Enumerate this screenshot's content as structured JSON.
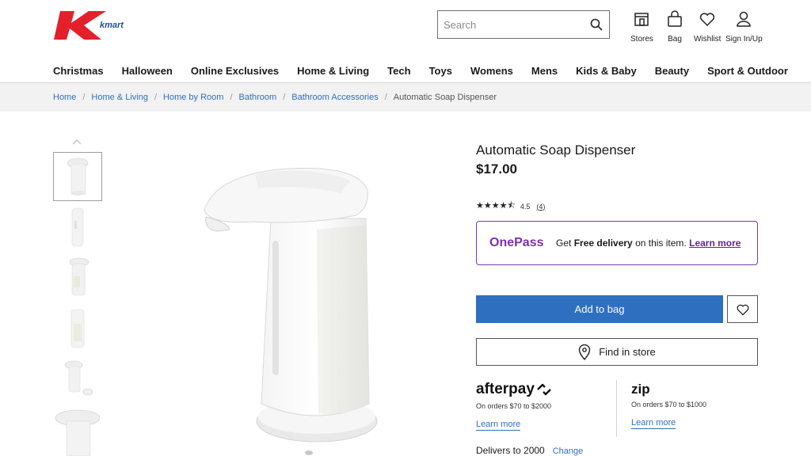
{
  "header": {
    "logo_text": "kmart",
    "search_placeholder": "Search",
    "utilities": [
      {
        "label": "Stores",
        "icon": "store-icon"
      },
      {
        "label": "Bag",
        "icon": "bag-icon"
      },
      {
        "label": "Wishlist",
        "icon": "heart-icon"
      },
      {
        "label": "Sign In/Up",
        "icon": "user-icon"
      }
    ]
  },
  "nav": [
    "Christmas",
    "Halloween",
    "Online Exclusives",
    "Home & Living",
    "Tech",
    "Toys",
    "Womens",
    "Mens",
    "Kids & Baby",
    "Beauty",
    "Sport & Outdoor"
  ],
  "breadcrumb": {
    "links": [
      "Home",
      "Home & Living",
      "Home by Room",
      "Bathroom",
      "Bathroom Accessories"
    ],
    "current": "Automatic Soap Dispenser"
  },
  "product": {
    "title": "Automatic Soap Dispenser",
    "price": "$17.00",
    "rating": 4.5,
    "rating_text": "4.5",
    "review_count": "(4)"
  },
  "onepass": {
    "brand": "OnePass",
    "msg_prefix": "Get ",
    "msg_bold": "Free delivery",
    "msg_suffix": " on this item. ",
    "learn_more": "Learn more"
  },
  "actions": {
    "add_to_bag": "Add to bag",
    "find_in_store": "Find in store"
  },
  "payments": {
    "afterpay": {
      "name": "afterpay",
      "orders": "On orders $70 to $2000",
      "learn_more": "Learn more"
    },
    "zip": {
      "name": "zip",
      "orders": "On orders $70 to $1000",
      "learn_more": "Learn more"
    }
  },
  "delivery": {
    "text": "Delivers to 2000",
    "change": "Change"
  },
  "colors": {
    "brand_red": "#e4202b",
    "link_blue": "#2f6fc0",
    "onepass_purple": "#7b2fb2"
  }
}
